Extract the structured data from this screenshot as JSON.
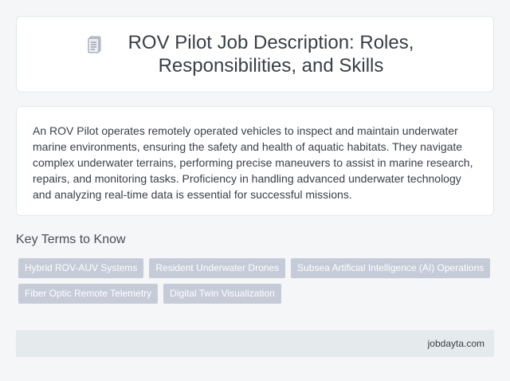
{
  "header": {
    "icon": "document-icon",
    "title": "ROV Pilot Job Description: Roles, Responsibilities, and Skills"
  },
  "description": {
    "text": "An ROV Pilot operates remotely operated vehicles to inspect and maintain underwater marine environments, ensuring the safety and health of aquatic habitats. They navigate complex underwater terrains, performing precise maneuvers to assist in marine research, repairs, and monitoring tasks. Proficiency in handling advanced underwater technology and analyzing real-time data is essential for successful missions."
  },
  "key_terms": {
    "heading": "Key Terms to Know",
    "items": [
      "Hybrid ROV-AUV Systems",
      "Resident Underwater Drones",
      "Subsea Artificial Intelligence (AI) Operations",
      "Fiber Optic Remote Telemetry",
      "Digital Twin Visualization"
    ]
  },
  "footer": {
    "site": "jobdayta.com"
  },
  "colors": {
    "background": "#f4f6f7",
    "card": "#ffffff",
    "tag": "#c6cbd8",
    "footer": "#e5ebec",
    "text": "#3a3e46"
  }
}
